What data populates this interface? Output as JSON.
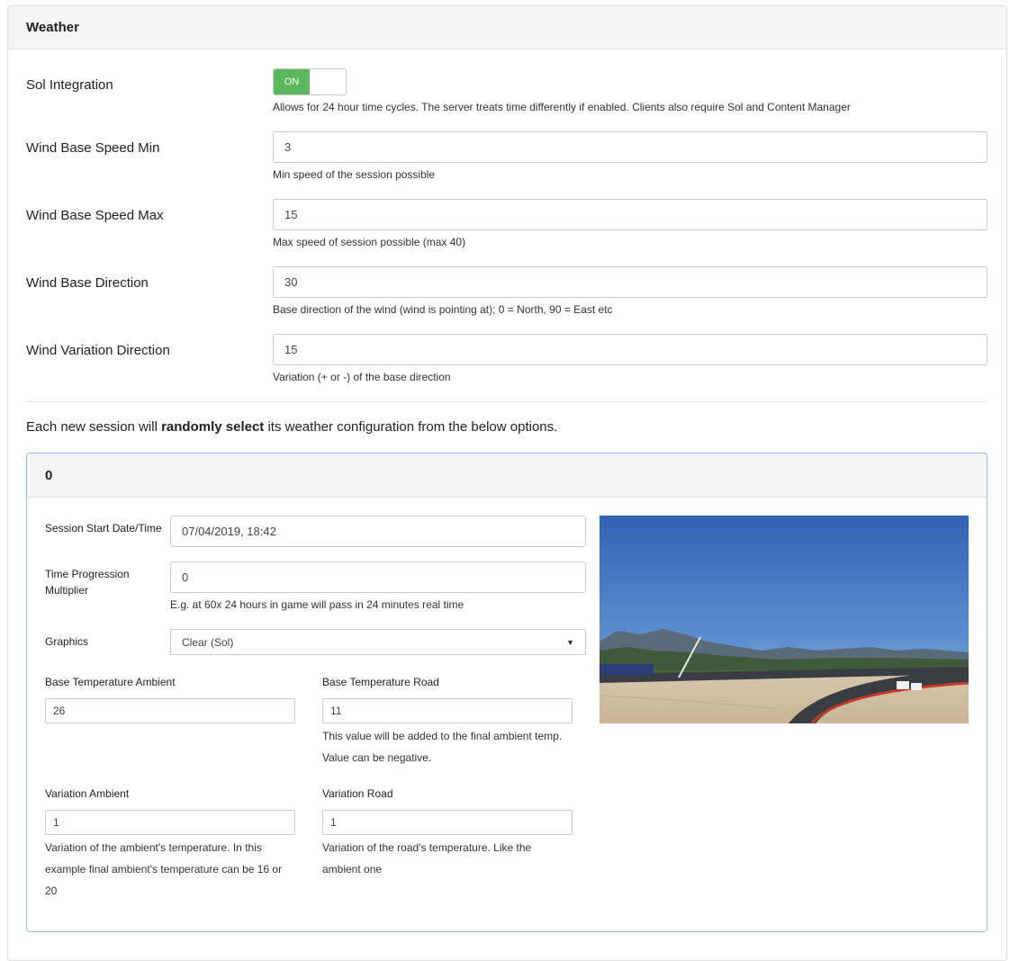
{
  "panel": {
    "title": "Weather"
  },
  "sol": {
    "label": "Sol Integration",
    "toggle_on_label": "ON",
    "toggle_state": "on",
    "help": "Allows for 24 hour time cycles. The server treats time differently if enabled. Clients also require Sol and Content Manager"
  },
  "fields": [
    {
      "label": "Wind Base Speed Min",
      "value": "3",
      "help": "Min speed of the session possible"
    },
    {
      "label": "Wind Base Speed Max",
      "value": "15",
      "help": "Max speed of session possible (max 40)"
    },
    {
      "label": "Wind Base Direction",
      "value": "30",
      "help": "Base direction of the wind (wind is pointing at); 0 = North, 90 = East etc"
    },
    {
      "label": "Wind Variation Direction",
      "value": "15",
      "help": "Variation (+ or -) of the base direction"
    }
  ],
  "intro": {
    "before": "Each new session will ",
    "bold": "randomly select",
    "after": " its weather configuration from the below options."
  },
  "weather": {
    "title": "0",
    "start_label": "Session Start Date/Time",
    "start_value": "07/04/2019, 18:42",
    "progression_label_1": "Time Progression",
    "progression_label_2": "Multiplier",
    "progression_value": "0",
    "progression_help": "E.g. at 60x 24 hours in game will pass in 24 minutes real time",
    "graphics_label": "Graphics",
    "graphics_value": "Clear (Sol)",
    "ambient_label": "Base Temperature Ambient",
    "ambient_value": "26",
    "road_label": "Base Temperature Road",
    "road_value": "11",
    "road_help_1": "This value will be added to the final ambient temp.",
    "road_help_2": "Value can be negative.",
    "var_ambient_label": "Variation Ambient",
    "var_ambient_value": "1",
    "var_ambient_help_1": "Variation of the ambient's temperature. In this",
    "var_ambient_help_2": "example final ambient's temperature can be 16 or",
    "var_ambient_help_3": "20",
    "var_road_label": "Variation Road",
    "var_road_value": "1",
    "var_road_help_1": "Variation of the road's temperature. Like the",
    "var_road_help_2": "ambient one"
  },
  "colors": {
    "toggle_on": "#5cb85c",
    "weather_border": "#8fc3e0"
  }
}
